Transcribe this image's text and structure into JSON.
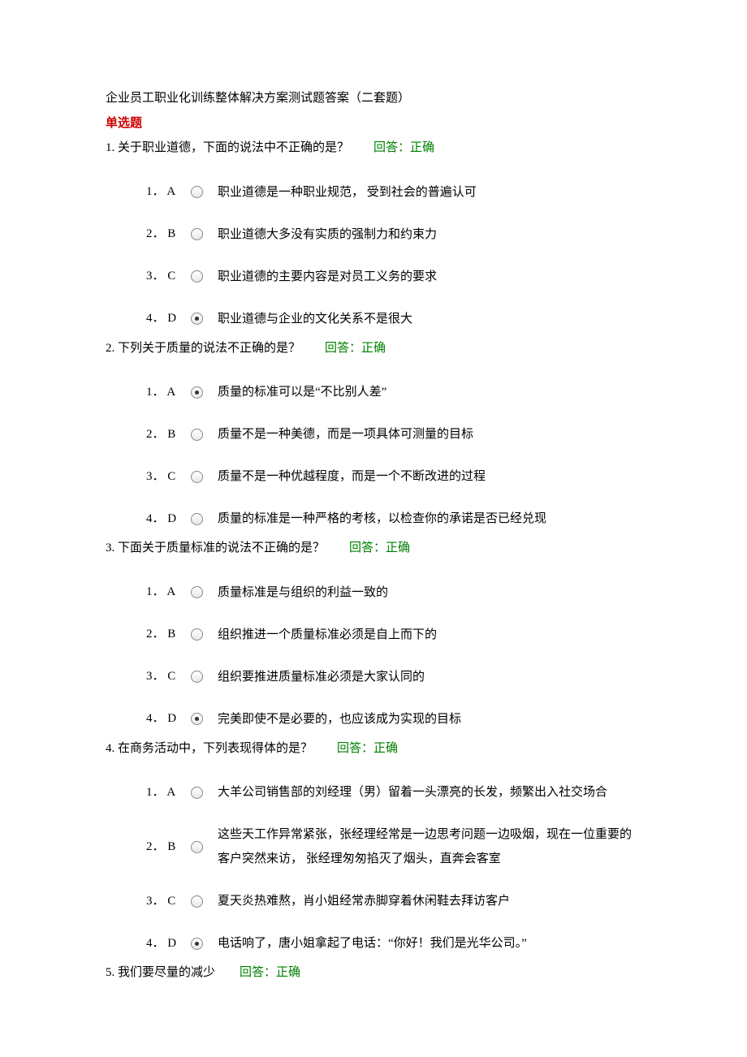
{
  "doc_title": "企业员工职业化训练整体解决方案测试题答案（二套题）",
  "section_heading": "单选题",
  "answer_label_prefix": "回答：",
  "answer_correct": "正确",
  "questions": [
    {
      "num": "1. ",
      "text": "关于职业道德，下面的说法中不正确的是？",
      "options": [
        {
          "idx": "1．",
          "letter": "A",
          "text": "职业道德是一种职业规范，  受到社会的普遍认可",
          "selected": false
        },
        {
          "idx": "2．",
          "letter": "B",
          "text": "职业道德大多没有实质的强制力和约束力",
          "selected": false
        },
        {
          "idx": "3．",
          "letter": "C",
          "text": "职业道德的主要内容是对员工义务的要求",
          "selected": false
        },
        {
          "idx": "4．",
          "letter": "D",
          "text": "职业道德与企业的文化关系不是很大",
          "selected": true
        }
      ]
    },
    {
      "num": "2. ",
      "text": "下列关于质量的说法不正确的是？",
      "options": [
        {
          "idx": "1．",
          "letter": "A",
          "text": "质量的标准可以是“不比别人差”",
          "selected": true
        },
        {
          "idx": "2．",
          "letter": "B",
          "text": "质量不是一种美德，而是一项具体可测量的目标",
          "selected": false
        },
        {
          "idx": "3．",
          "letter": "C",
          "text": "质量不是一种优越程度，而是一个不断改进的过程",
          "selected": false
        },
        {
          "idx": "4．",
          "letter": "D",
          "text": "质量的标准是一种严格的考核，以检查你的承诺是否已经兑现",
          "selected": false
        }
      ]
    },
    {
      "num": "3. ",
      "text": "下面关于质量标准的说法不正确的是？",
      "options": [
        {
          "idx": "1．",
          "letter": "A",
          "text": "质量标准是与组织的利益一致的",
          "selected": false
        },
        {
          "idx": "2．",
          "letter": "B",
          "text": "组织推进一个质量标准必须是自上而下的",
          "selected": false
        },
        {
          "idx": "3．",
          "letter": "C",
          "text": "组织要推进质量标准必须是大家认同的",
          "selected": false
        },
        {
          "idx": "4．",
          "letter": "D",
          "text": "完美即使不是必要的，也应该成为实现的目标",
          "selected": true
        }
      ]
    },
    {
      "num": "4. ",
      "text": "在商务活动中，下列表现得体的是？",
      "options": [
        {
          "idx": "1．",
          "letter": "A",
          "text": "大羊公司销售部的刘经理（男）留着一头漂亮的长发，频繁出入社交场合",
          "selected": false
        },
        {
          "idx": "2．",
          "letter": "B",
          "text": "这些天工作异常紧张，张经理经常是一边思考问题一边吸烟，现在一位重要的客户突然来访，  张经理匆匆掐灭了烟头，直奔会客室",
          "selected": false
        },
        {
          "idx": "3．",
          "letter": "C",
          "text": "夏天炎热难熬，肖小姐经常赤脚穿着休闲鞋去拜访客户",
          "selected": false
        },
        {
          "idx": "4．",
          "letter": "D",
          "text": "电话响了，唐小姐拿起了电话：“你好！我们是光华公司。”",
          "selected": true
        }
      ]
    },
    {
      "num": "5. ",
      "text": "我们要尽量的减少",
      "options": []
    }
  ]
}
